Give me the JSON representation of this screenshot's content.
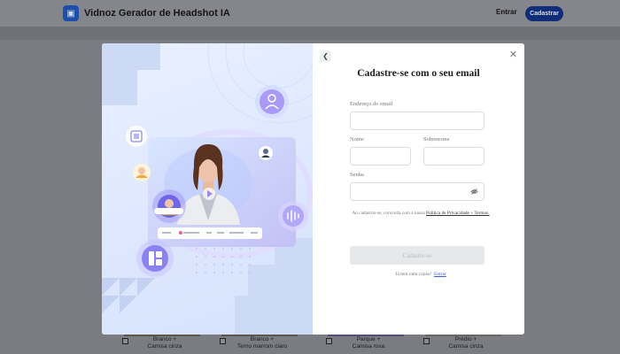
{
  "header": {
    "app_title": "Vidnoz Gerador de Headshot IA",
    "login_label": "Entrar",
    "signup_label": "Cadastrar"
  },
  "background_cards": [
    {
      "caption_line1": "Branco +",
      "caption_line2": "Camisa cinza"
    },
    {
      "caption_line1": "Branco +",
      "caption_line2": "Terno marrom claro"
    },
    {
      "caption_line1": "Parque +",
      "caption_line2": "Camisa roxa"
    },
    {
      "caption_line1": "Prédio +",
      "caption_line2": "Camisa cinza"
    }
  ],
  "modal": {
    "title": "Cadastre-se com o seu email",
    "email_label": "Endereço de email",
    "email_value": "",
    "first_name_label": "Nome",
    "first_name_value": "",
    "last_name_label": "Sobrenome",
    "last_name_value": "",
    "password_label": "Senha",
    "password_value": "",
    "terms_prefix": "Ao cadastrar-se, concorda com a nossa",
    "terms_link": "Política de Privacidade + Termos.",
    "submit_label": "Cadastre-se",
    "login_prompt": "Já tem uma conta?",
    "login_link": "Entrar"
  },
  "icons": {
    "back": "chevron-left-icon",
    "close": "close-icon",
    "password_toggle": "eye-off-icon",
    "logo": "vidnoz-logo-icon"
  },
  "colors": {
    "brand": "#0f2d78",
    "link": "#3b5bdb",
    "submit_disabled_bg": "#e7e8ea",
    "hero_bg": "#dfe9ff"
  }
}
